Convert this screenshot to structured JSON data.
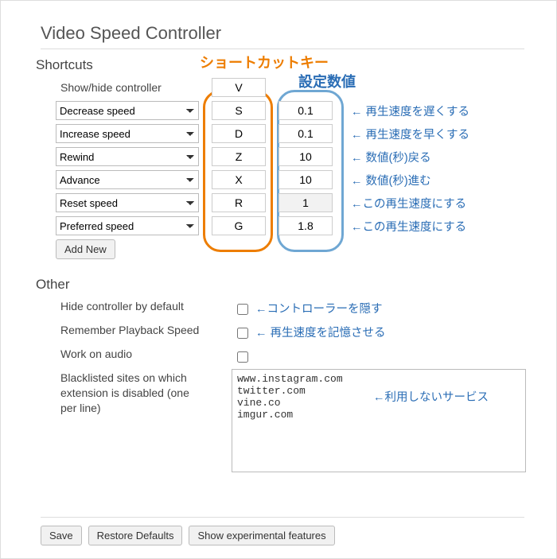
{
  "title": "Video Speed Controller",
  "annotations": {
    "shortcut_key": "ショートカットキー",
    "setting_value": "設定数値"
  },
  "shortcuts": {
    "heading": "Shortcuts",
    "show_hide": {
      "label": "Show/hide controller",
      "key": "V"
    },
    "rows": [
      {
        "action": "Decrease speed",
        "key": "S",
        "value": "0.1",
        "note": "← 再生速度を遅くする"
      },
      {
        "action": "Increase speed",
        "key": "D",
        "value": "0.1",
        "note": "← 再生速度を早くする"
      },
      {
        "action": "Rewind",
        "key": "Z",
        "value": "10",
        "note": "← 数値(秒)戻る"
      },
      {
        "action": "Advance",
        "key": "X",
        "value": "10",
        "note": "← 数値(秒)進む"
      },
      {
        "action": "Reset speed",
        "key": "R",
        "value": "1",
        "note": "←この再生速度にする",
        "dim": true
      },
      {
        "action": "Preferred speed",
        "key": "G",
        "value": "1.8",
        "note": "←この再生速度にする"
      }
    ],
    "add_new": "Add New"
  },
  "other": {
    "heading": "Other",
    "hide_controller": {
      "label": "Hide controller by default",
      "checked": false,
      "note": "←コントローラーを隠す"
    },
    "remember_playback": {
      "label": "Remember Playback Speed",
      "checked": false,
      "note": "← 再生速度を記憶させる"
    },
    "work_on_audio": {
      "label": "Work on audio",
      "checked": false
    },
    "blacklist": {
      "label": "Blacklisted sites on which extension is disabled (one per line)",
      "value": "www.instagram.com\ntwitter.com\nvine.co\nimgur.com",
      "note": "←利用しないサービス"
    }
  },
  "footer": {
    "save": "Save",
    "restore": "Restore Defaults",
    "experimental": "Show experimental features"
  }
}
